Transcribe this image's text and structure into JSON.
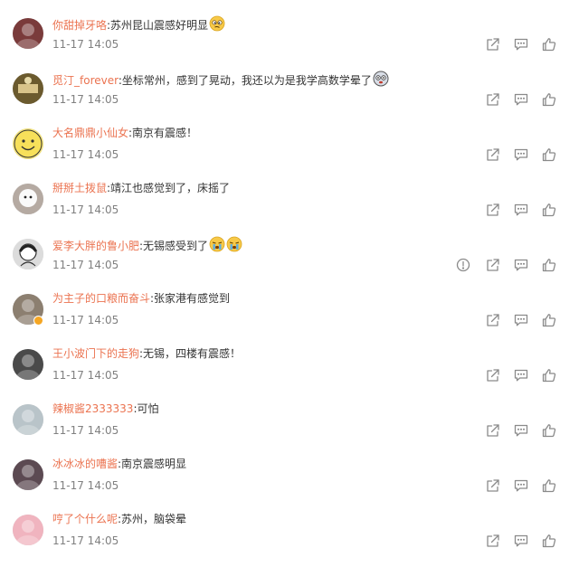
{
  "comments": [
    {
      "user": "你甜掉牙咯",
      "text": ":苏州昆山震感好明显",
      "time": "11-17 14:05",
      "emoji": [
        "woozy"
      ],
      "report": false,
      "verified": false,
      "avatar_color": "#7a3b3b"
    },
    {
      "user": "觅汀_forever",
      "text": ":坐标常州，感到了晃动，我还以为是我学高数学晕了",
      "time": "11-17 14:05",
      "emoji": [
        "dizzy-round"
      ],
      "report": false,
      "verified": false,
      "avatar_color": "#6b5a2e"
    },
    {
      "user": "大名鼎鼎小仙女",
      "text": ":南京有震感！",
      "time": "11-17 14:05",
      "emoji": [],
      "report": false,
      "verified": false,
      "avatar_color": "#f3e27a"
    },
    {
      "user": "掰掰土拨鼠",
      "text": ":靖江也感觉到了，床摇了",
      "time": "11-17 14:05",
      "emoji": [],
      "report": false,
      "verified": false,
      "avatar_color": "#b5aaa2"
    },
    {
      "user": "爱李大胖的鲁小肥",
      "text": ":无锡感受到了",
      "time": "11-17 14:05",
      "emoji": [
        "crying",
        "crying"
      ],
      "report": true,
      "verified": false,
      "avatar_color": "#dcdcdc"
    },
    {
      "user": "为主子的口粮而奋斗",
      "text": ":张家港有感觉到",
      "time": "11-17 14:05",
      "emoji": [],
      "report": false,
      "verified": true,
      "avatar_color": "#8c7f70"
    },
    {
      "user": "王小波门下的走狗",
      "text": ":无锡，四楼有震感！",
      "time": "11-17 14:05",
      "emoji": [],
      "report": false,
      "verified": false,
      "avatar_color": "#4a4a4a"
    },
    {
      "user": "辣椒酱2333333",
      "text": ":可怕",
      "time": "11-17 14:05",
      "emoji": [],
      "report": false,
      "verified": false,
      "avatar_color": "#b9c4c9"
    },
    {
      "user": "冰冰冰的嘈酱",
      "text": ":南京震感明显",
      "time": "11-17 14:05",
      "emoji": [],
      "report": false,
      "verified": false,
      "avatar_color": "#5c4a52"
    },
    {
      "user": "哼了个什么呢",
      "text": ":苏州，脑袋晕",
      "time": "11-17 14:05",
      "emoji": [],
      "report": false,
      "verified": false,
      "avatar_color": "#f0b4bf"
    }
  ],
  "icons": {
    "report": "report-icon",
    "forward": "forward-icon",
    "comment": "comment-icon",
    "like": "like-icon"
  },
  "colors": {
    "username": "#eb7350",
    "text": "#333333",
    "time": "#808080",
    "icon": "#8a8a8a"
  }
}
